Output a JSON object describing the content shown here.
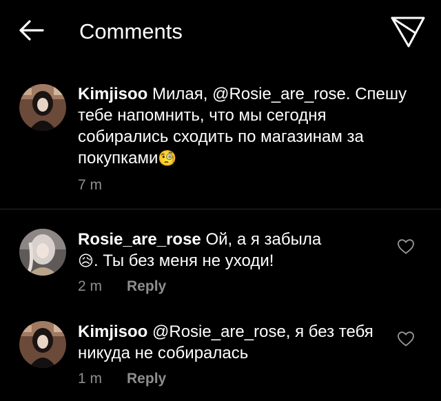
{
  "header": {
    "title": "Comments",
    "back_icon": "arrow-left-icon",
    "send_icon": "send-paper-plane-icon"
  },
  "colors": {
    "background": "#000000",
    "text": "#ffffff",
    "secondary": "#8e8e8e",
    "divider": "#2a2a2a"
  },
  "caption": {
    "username": "Kimjisoo",
    "text": " Милая, @Rosie_are_rose. Спешу тебе напомнить, что мы сегодня собирались сходить по магазинам за покупками",
    "emoji": "🧐",
    "time": "7 m"
  },
  "comments": [
    {
      "username": "Rosie_are_rose",
      "text_before": " Ой, а я забыла",
      "emoji": "😥",
      "text_after": ". Ты без меня не уходи!",
      "time": "2 m",
      "reply_label": "Reply"
    },
    {
      "username": "Kimjisoo",
      "text": " @Rosie_are_rose, я без тебя никуда не собиралась",
      "time": "1 m",
      "reply_label": "Reply"
    }
  ]
}
